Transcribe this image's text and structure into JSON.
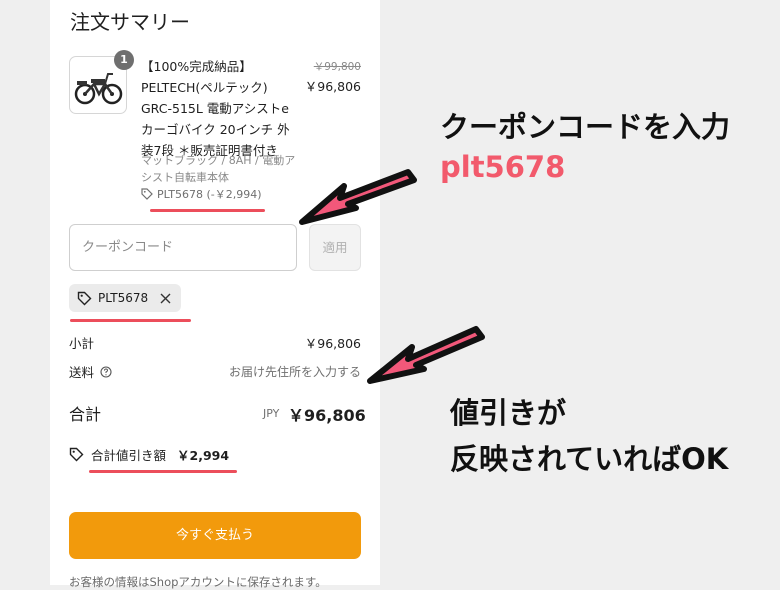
{
  "summary": {
    "title": "注文サマリー",
    "item": {
      "quantity": "1",
      "name": "【100%完成納品】PELTECH(ペルテック) GRC-515L 電動アシストeカーゴバイク 20インチ 外装7段 ＊販売証明書付き",
      "variant": "マットブラック / 8AH / 電動アシスト自転車本体",
      "discount_code_line": "PLT5678 (-￥2,994)",
      "original_price": "￥99,800",
      "price": "￥96,806"
    },
    "coupon": {
      "placeholder": "クーポンコード",
      "apply_label": "適用",
      "applied_code": "PLT5678"
    },
    "subtotal": {
      "label": "小計",
      "value": "￥96,806"
    },
    "shipping": {
      "label": "送料",
      "value": "お届け先住所を入力する"
    },
    "total": {
      "label": "合計",
      "currency": "JPY",
      "value": "￥96,806"
    },
    "savings": {
      "label": "合計値引き額",
      "value": "￥2,994"
    },
    "pay_button": "今すぐ支払う",
    "footer_note": "お客様の情報はShopアカウントに保存されます。"
  },
  "annotations": {
    "enter_coupon": "クーポンコードを入力",
    "code": "plt5678",
    "reflected_line1": "値引きが",
    "reflected_line2": "反映されていればOK"
  },
  "colors": {
    "accent_arrow": "#f2587a",
    "underline": "#ec4e5b",
    "pay_button": "#f29a0c"
  }
}
